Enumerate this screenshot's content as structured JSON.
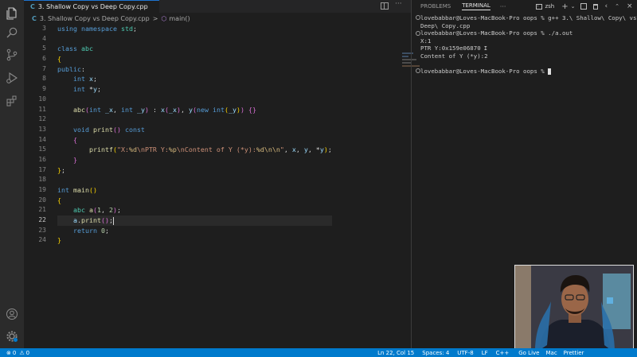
{
  "tab": {
    "icon_letter": "C",
    "title": "3. Shallow Copy vs Deep Copy.cpp"
  },
  "breadcrumb": {
    "icon_letter": "C",
    "file": "3. Shallow Copy vs Deep Copy.cpp",
    "separator": ">",
    "symbol": "main()"
  },
  "editor": {
    "line_numbers": [
      "3",
      "4",
      "5",
      "6",
      "7",
      "8",
      "9",
      "10",
      "11",
      "12",
      "13",
      "14",
      "15",
      "16",
      "17",
      "18",
      "19",
      "20",
      "21",
      "22",
      "23",
      "24"
    ],
    "current_line": "22"
  },
  "panel": {
    "tabs": [
      {
        "label": "PROBLEMS"
      },
      {
        "label": "TERMINAL"
      }
    ],
    "more": "···",
    "shell": "zsh"
  },
  "terminal": {
    "lines": [
      "lovebabbar@Loves-MacBook-Pro oops % g++ 3.\\ Shallow\\ Copy\\ vs\\",
      "Deep\\ Copy.cpp",
      "lovebabbar@Loves-MacBook-Pro oops % ./a.out",
      "X:1",
      "PTR Y:0x159e06870",
      "Content of Y (*y):2",
      "",
      "lovebabbar@Loves-MacBook-Pro oops % "
    ]
  },
  "statusbar": {
    "errors": "0",
    "warnings": "0",
    "position": "Ln 22, Col 15",
    "spaces": "Spaces: 4",
    "encoding": "UTF-8",
    "eol": "LF",
    "language": "C++",
    "golive": "Go Live",
    "platform": "Mac",
    "prettier": "Prettier"
  },
  "colors": {
    "accent": "#007acc",
    "editor_bg": "#1e1e1e"
  },
  "icons": [
    "files-icon",
    "search-icon",
    "source-control-icon",
    "run-debug-icon",
    "extensions-icon",
    "account-icon",
    "manage-gear-icon",
    "split-editor-icon",
    "more-actions-icon"
  ]
}
